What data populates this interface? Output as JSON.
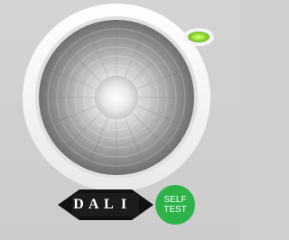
{
  "product": {
    "name": "LED downlight",
    "indicator_color": "#9be03a",
    "background_color": "#cfcfd0",
    "ring_color": "#ffffff"
  },
  "badges": {
    "dali": {
      "letters": [
        "D",
        "A",
        "L",
        "I"
      ],
      "color": "#111111",
      "icon": "dali-logo-icon"
    },
    "selftest": {
      "line1": "SELF",
      "line2": "TEST",
      "color": "#2db34a",
      "icon": "self-test-badge"
    }
  }
}
